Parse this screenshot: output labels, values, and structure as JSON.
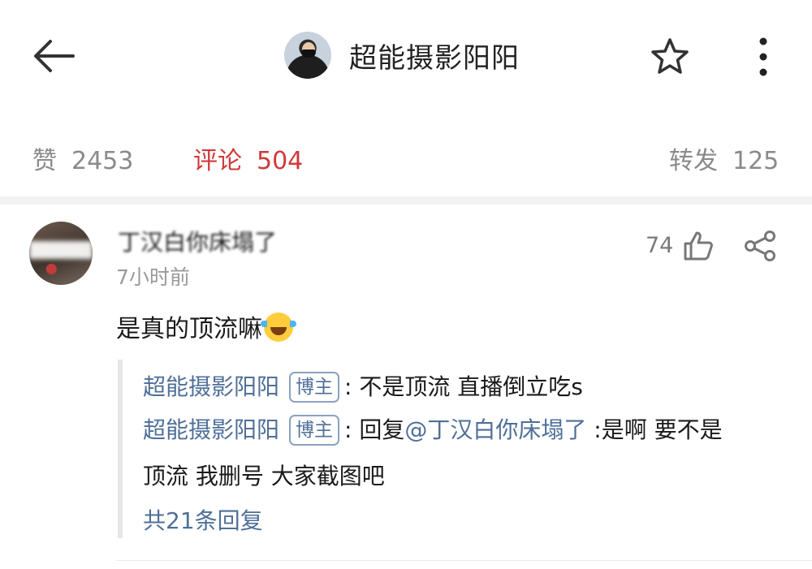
{
  "header": {
    "title": "超能摄影阳阳",
    "back_icon": "arrow-left-icon",
    "favorite_icon": "star-outline-icon",
    "more_icon": "more-vertical-icon"
  },
  "stats": {
    "likes_label": "赞",
    "likes_count": "2453",
    "comments_label": "评论",
    "comments_count": "504",
    "reposts_label": "转发",
    "reposts_count": "125",
    "active_color": "#d03a3a"
  },
  "comment": {
    "username": "丁汉白你床塌了",
    "time": "7小时前",
    "like_count": "74",
    "like_icon": "thumbs-up-icon",
    "share_icon": "share-icon",
    "text": "是真的顶流嘛",
    "emoji": "laughing-tears-emoji",
    "replies": [
      {
        "name": "超能摄影阳阳",
        "badge": "博主",
        "text": ": 不是顶流 直播倒立吃s"
      },
      {
        "name": "超能摄影阳阳",
        "badge": "博主",
        "prefix": ": 回复",
        "mention": "@丁汉白你床塌了",
        "text": " :是啊 要不是",
        "continuation": "顶流 我删号 大家截图吧"
      }
    ],
    "more_replies": "共21条回复",
    "link_color": "#4f6f98"
  }
}
